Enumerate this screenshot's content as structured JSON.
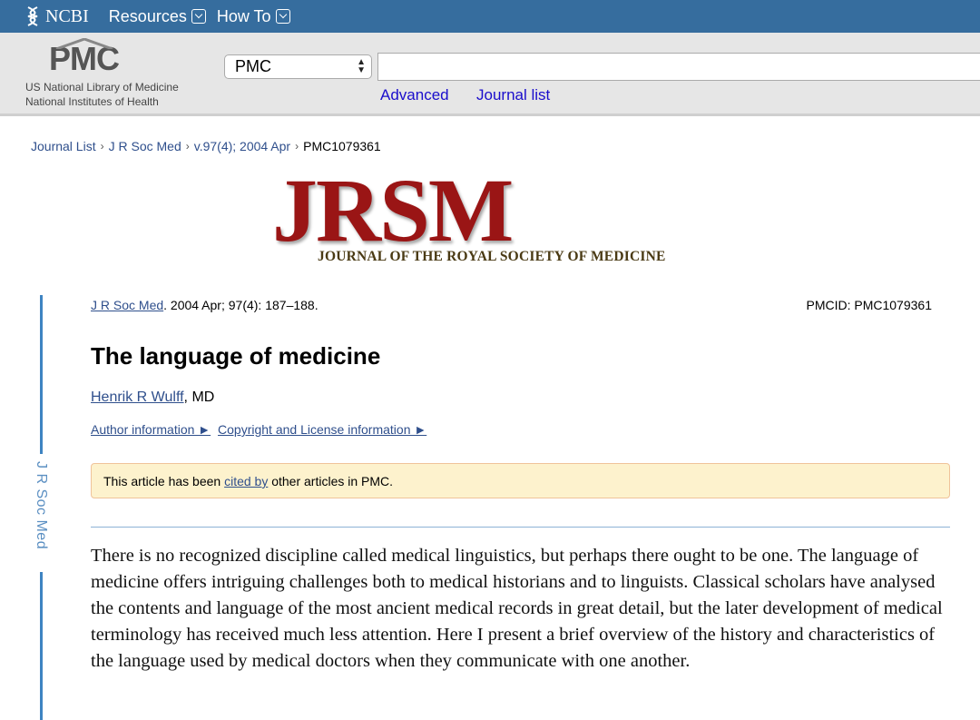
{
  "ncbi_bar": {
    "logo_text": "NCBI",
    "menus": [
      {
        "label": "Resources",
        "icon": "chevron-down-icon"
      },
      {
        "label": "How To",
        "icon": "chevron-down-icon"
      }
    ]
  },
  "pmc_header": {
    "logo_text": "PMC",
    "org_line1": "US National Library of Medicine",
    "org_line2": "National Institutes of Health",
    "database_select": "PMC",
    "search_value": "",
    "links": [
      "Advanced",
      "Journal list"
    ]
  },
  "breadcrumb": [
    "Journal List",
    "J R Soc Med",
    "v.97(4); 2004 Apr",
    "PMC1079361"
  ],
  "journal_banner": {
    "acronym": "JRSM",
    "full_name": "JOURNAL OF THE ROYAL SOCIETY OF MEDICINE"
  },
  "side_rail_label": "J R Soc Med",
  "article": {
    "journal_abbrev": "J R Soc Med",
    "citation_rest": ". 2004 Apr; 97(4): 187–188.",
    "pmcid": "PMCID: PMC1079361",
    "title": "The language of medicine",
    "author_name": "Henrik R Wulff",
    "author_suffix": ", MD",
    "author_info_link": "Author information ►",
    "copyright_link": "Copyright and License information ►",
    "notice_prefix": "This article has been ",
    "notice_link": "cited by",
    "notice_suffix": " other articles in PMC.",
    "body": "There is no recognized discipline called medical linguistics, but perhaps there ought to be one. The language of medicine offers intriguing challenges both to medical historians and to linguists. Classical scholars have analysed the contents and language of the most ancient medical records in great detail, but the later development of medical terminology has received much less attention. Here I present a brief overview of the history and characteristics of the language used by medical doctors when they communicate with one another."
  },
  "colors": {
    "ncbi_blue": "#366d9e",
    "link_blue": "#2f4f8c",
    "jrsm_red": "#9a1515",
    "notice_bg": "#fdf2cd",
    "rail_blue": "#3e84c2"
  }
}
